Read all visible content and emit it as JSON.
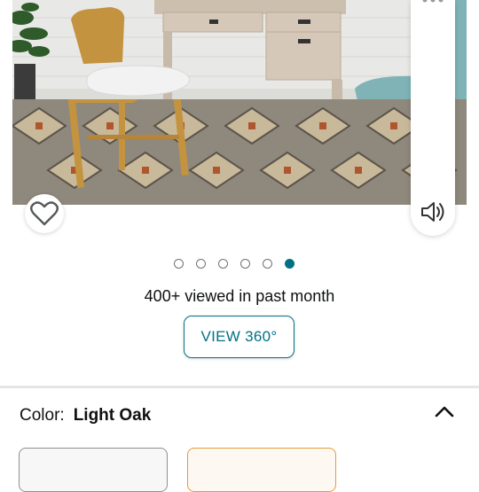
{
  "product_image": {
    "description_icon": "product-photo-desk-and-chair"
  },
  "carousel": {
    "total_dots": 6,
    "active_index": 5
  },
  "engagement": {
    "viewed_text": "400+ viewed in past month"
  },
  "view360": {
    "label": "VIEW 360°"
  },
  "variation": {
    "color_label": "Color:",
    "color_value": "Light Oak"
  },
  "colors": {
    "accent": "#007185",
    "swatch_selected_border": "#e59c3a"
  }
}
